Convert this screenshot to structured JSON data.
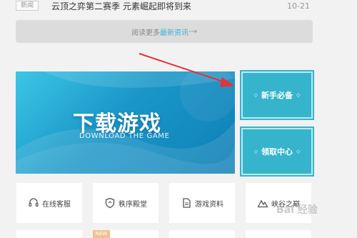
{
  "news": {
    "tag": "新闻",
    "title": "云顶之弈第二赛季 元素崛起即将到来",
    "date": "10-21"
  },
  "more": {
    "prefix": "阅读更多",
    "accent": "最新资讯",
    "arrow": " -→"
  },
  "banner": {
    "title": "下载游戏",
    "subtitle": "DOWNLOAD THE GAME"
  },
  "side": [
    {
      "label": "新手必备",
      "icon": "diamond-bullet-icon"
    },
    {
      "label": "领取中心",
      "icon": "diamond-bullet-icon"
    }
  ],
  "tiles": [
    {
      "label": "在线客服",
      "icon": "headset-icon"
    },
    {
      "label": "秩序殿堂",
      "icon": "shield-icon"
    },
    {
      "label": "游戏资料",
      "icon": "document-icon"
    },
    {
      "label": "峡谷之巅",
      "icon": "mountain-icon"
    }
  ],
  "second_row": {
    "badge": "NEW"
  },
  "watermark": "Bai 经验",
  "colors": {
    "accent": "#3ab0d6",
    "side_button": "#35b4cc",
    "arrow": "#e8303a",
    "page_bg": "#f2f2f2"
  }
}
